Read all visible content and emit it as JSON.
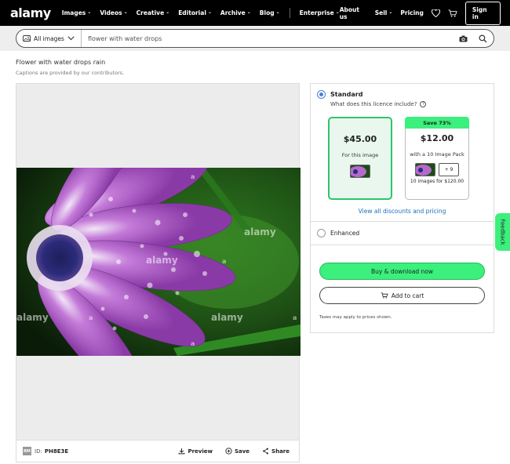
{
  "nav": {
    "logo": "alamy",
    "links": [
      "Images",
      "Videos",
      "Creative",
      "Editorial",
      "Archive",
      "Blog"
    ],
    "enterprise": "Enterprise",
    "about": "About us",
    "sell": "Sell",
    "pricing": "Pricing",
    "signin": "Sign in"
  },
  "search": {
    "filter": "All images",
    "query": "flower with water drops"
  },
  "page": {
    "title": "Flower with water drops rain",
    "caption": "Captions are provided by our contributors."
  },
  "image": {
    "badge": "RM",
    "id_label": "ID:",
    "id": "PH8E3E",
    "watermark": "alamy",
    "preview": "Preview",
    "save": "Save",
    "share": "Share"
  },
  "licence": {
    "standard": "Standard",
    "question": "What does this licence include?",
    "single_price": "$45.00",
    "single_sub": "For this image",
    "save_tag": "Save 73%",
    "pack_price": "$12.00",
    "pack_sub": "with a 10 Image Pack",
    "pack_plus": "+ 9",
    "pack_note": "10 images for $120.00",
    "view_all": "View all discounts and pricing",
    "enhanced": "Enhanced",
    "buy": "Buy & download now",
    "cart": "Add to cart",
    "taxes": "Taxes may apply to prices shown."
  },
  "feedback": "Feedback",
  "colors": {
    "accent_green": "#3bf07c",
    "link_blue": "#1e6fb8",
    "radio_blue": "#4a7fd4"
  }
}
